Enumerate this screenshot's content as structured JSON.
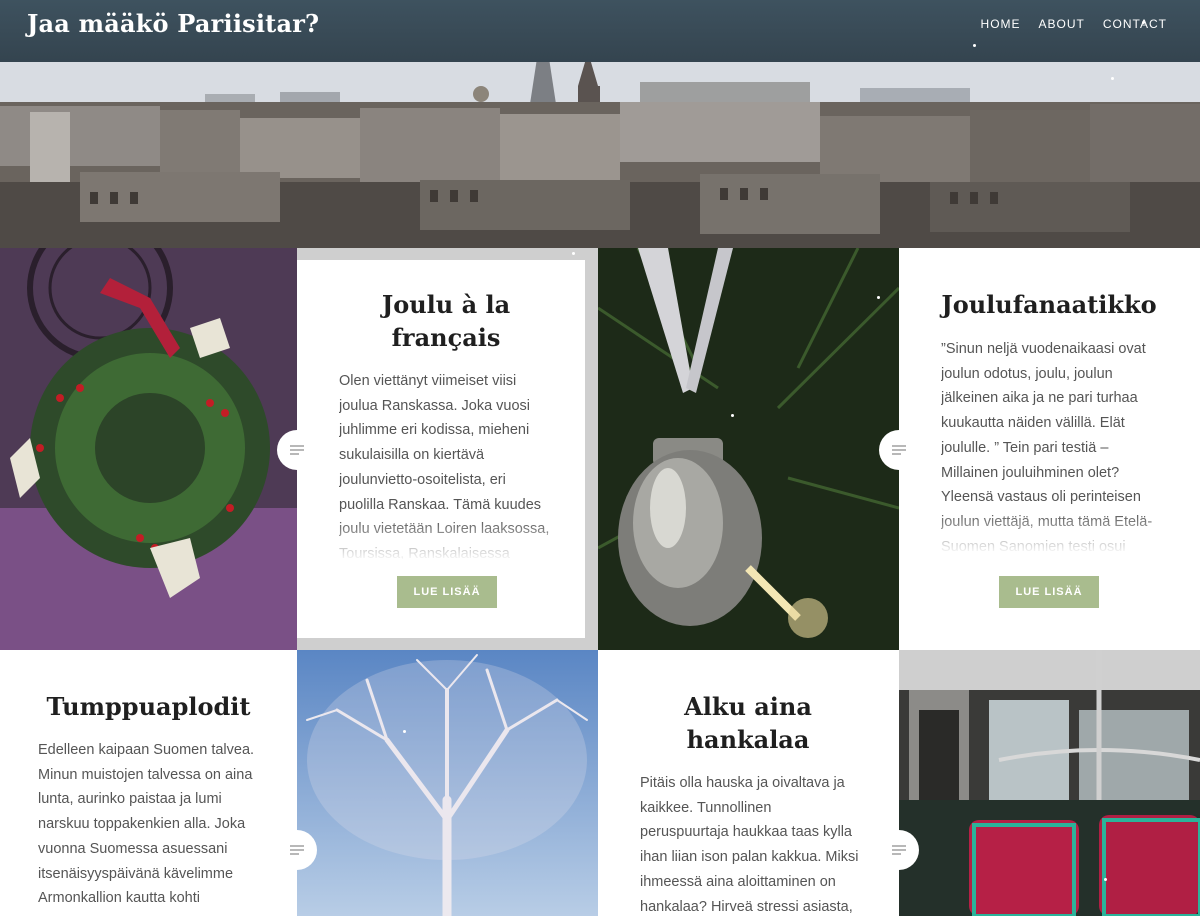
{
  "site": {
    "title": "Jaa määkö Pariisitar?"
  },
  "nav": {
    "items": [
      {
        "label": "HOME"
      },
      {
        "label": "ABOUT"
      },
      {
        "label": "CONTACT"
      }
    ]
  },
  "posts": [
    {
      "title": "Joulu à la français",
      "excerpt": "Olen viettänyt viimeiset viisi joulua Ranskassa. Joka vuosi juhlimme eri kodissa, mieheni sukulaisilla on kiertävä joulunvietto-osoitelista, eri puolilla Ranskaa. Tämä kuudes joulu vietetään Loiren laaksossa, Toursissa, Ranskalaisessa",
      "button": "LUE LISÄÄ",
      "icon": "post-format-icon"
    },
    {
      "title": "Joulufanaatikko",
      "excerpt": "”Sinun neljä vuodenaikaasi ovat joulun odotus, joulu, joulun jälkeinen aika ja ne pari turhaa kuukautta näiden välillä. Elät joululle. ” Tein pari testiä – Millainen jouluihminen olet? Yleensä vastaus oli perinteisen joulun viettäjä, mutta tämä Etelä-Suomen Sanomien testi osui asian",
      "button": "LUE LISÄÄ",
      "icon": "post-format-icon"
    },
    {
      "title": "Tumppuaplodit",
      "excerpt": "Edelleen kaipaan Suomen talvea. Minun muistojen talvessa on aina lunta, aurinko paistaa ja lumi narskuu toppakenkien alla. Joka vuonna Suomessa asuessani itsenäisyyspäivänä kävelimme Armonkallion kautta kohti",
      "icon": "post-format-icon"
    },
    {
      "title": "Alku aina hankalaa",
      "excerpt": "Pitäis olla hauska ja oivaltava ja kaikkee. Tunnollinen peruspuurtaja haukkaa taas kylla ihan liian ison palan kakkua. Miksi ihmeessä aina aloittaminen on hankalaa? Hirveä stressi asiasta,",
      "icon": "post-format-icon"
    }
  ],
  "images": [
    {
      "name": "christmas-wreath-image"
    },
    {
      "name": "glass-ornament-image"
    },
    {
      "name": "frosted-tree-image"
    },
    {
      "name": "metro-carriage-image"
    }
  ],
  "colors": {
    "header": "#3e525f",
    "button": "#a9bc8e",
    "title": "#1f1f1f",
    "text": "#555555"
  }
}
